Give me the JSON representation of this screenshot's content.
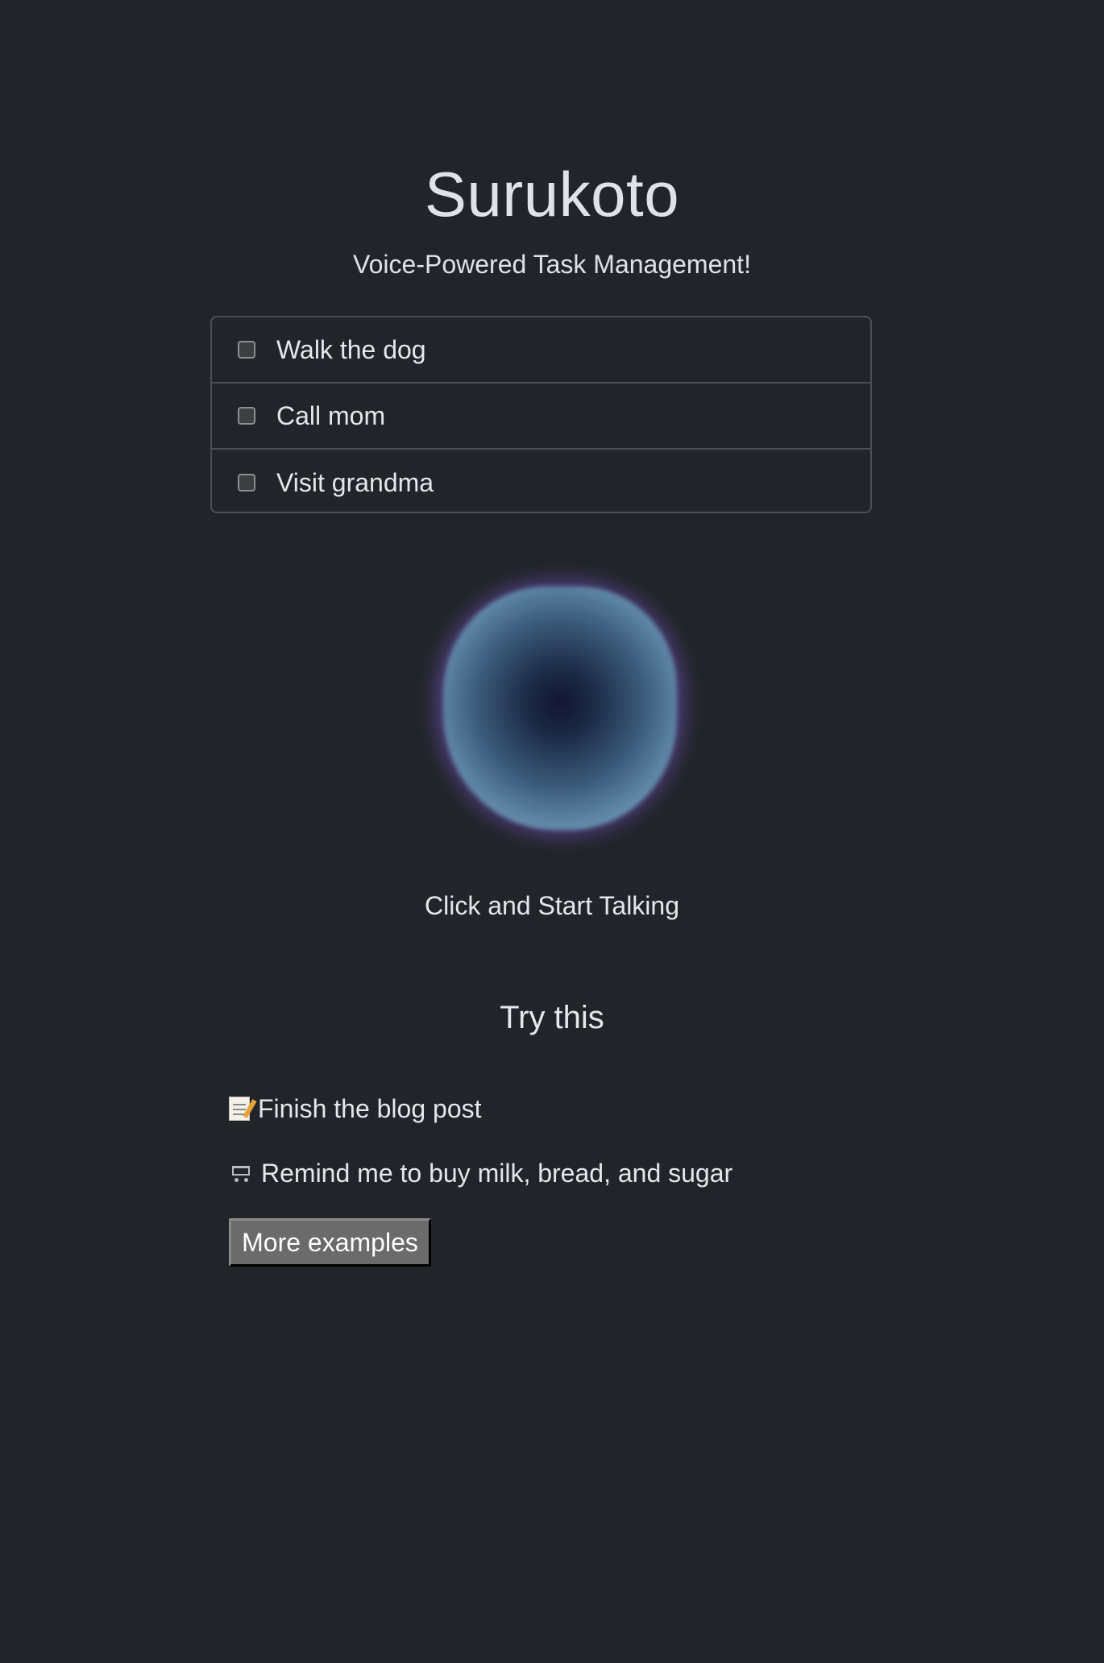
{
  "header": {
    "title": "Surukoto",
    "subtitle": "Voice-Powered Task Management!"
  },
  "tasks": [
    {
      "label": "Walk the dog",
      "checked": false
    },
    {
      "label": "Call mom",
      "checked": false
    },
    {
      "label": "Visit grandma",
      "checked": false
    }
  ],
  "voice": {
    "orb_icon": "voice-orb",
    "prompt": "Click and Start Talking"
  },
  "examples": {
    "heading": "Try this",
    "items": [
      {
        "icon": "memo-icon",
        "text": "Finish the blog post"
      },
      {
        "icon": "shopping-cart-icon",
        "text": "Remind me to buy milk, bread, and sugar"
      }
    ],
    "more_label": "More examples"
  },
  "colors": {
    "background": "#212429",
    "text": "#dfe3e8",
    "border": "#4b5058",
    "button": "#6b6b6b"
  }
}
